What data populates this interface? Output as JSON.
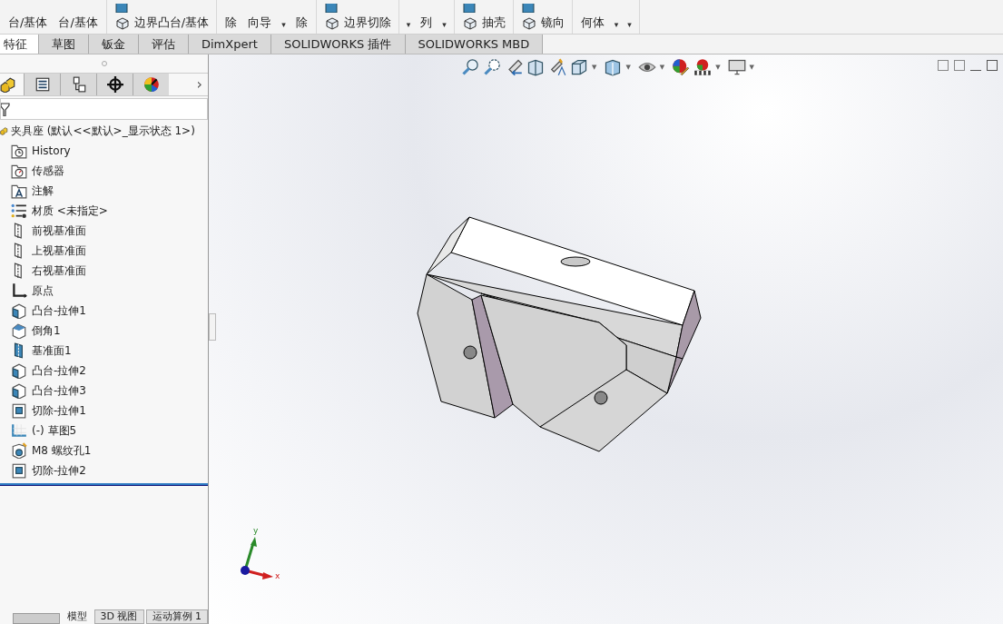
{
  "ribbon": {
    "groups": [
      {
        "items": [
          {
            "kind": "big",
            "label": "台/基体"
          },
          {
            "kind": "big",
            "label": "台/基体"
          }
        ]
      },
      {
        "items": [
          {
            "kind": "icon"
          },
          {
            "kind": "small",
            "label": "边界凸台/基体"
          }
        ]
      },
      {
        "items": [
          {
            "kind": "big",
            "label": "除"
          },
          {
            "kind": "big",
            "label": "向导"
          },
          {
            "kind": "caret",
            "label": "▾"
          },
          {
            "kind": "big",
            "label": "除"
          }
        ]
      },
      {
        "items": [
          {
            "kind": "icon"
          },
          {
            "kind": "small",
            "label": "边界切除"
          }
        ]
      },
      {
        "items": [
          {
            "kind": "caret",
            "label": "▾"
          },
          {
            "kind": "big",
            "label": "列"
          },
          {
            "kind": "caret",
            "label": "▾"
          }
        ]
      },
      {
        "items": [
          {
            "kind": "icon"
          },
          {
            "kind": "small",
            "label": "抽壳"
          }
        ]
      },
      {
        "items": [
          {
            "kind": "icon"
          },
          {
            "kind": "small",
            "label": "镜向"
          }
        ]
      },
      {
        "items": [
          {
            "kind": "big",
            "label": "何体"
          },
          {
            "kind": "caret",
            "label": "▾"
          },
          {
            "kind": "caret",
            "label": "▾"
          }
        ]
      }
    ]
  },
  "tabs": [
    {
      "label": "特征",
      "selected": true
    },
    {
      "label": "草图",
      "selected": false
    },
    {
      "label": "钣金",
      "selected": false
    },
    {
      "label": "评估",
      "selected": false
    },
    {
      "label": "DimXpert",
      "selected": false
    },
    {
      "label": "SOLIDWORKS 插件",
      "selected": false
    },
    {
      "label": "SOLIDWORKS MBD",
      "selected": false
    }
  ],
  "panel_tabs": [
    {
      "selected": true
    },
    {
      "selected": false
    },
    {
      "selected": false
    },
    {
      "selected": false
    },
    {
      "selected": false
    }
  ],
  "panel_more": "›",
  "tree": {
    "root": "夹具座  (默认<<默认>_显示状态 1>)",
    "children": [
      {
        "kind": "history",
        "label": "History"
      },
      {
        "kind": "sensor",
        "label": "传感器"
      },
      {
        "kind": "annotation",
        "label": "注解"
      },
      {
        "kind": "material",
        "label": "材质 <未指定>"
      },
      {
        "kind": "plane",
        "label": "前视基准面"
      },
      {
        "kind": "plane",
        "label": "上视基准面"
      },
      {
        "kind": "plane",
        "label": "右视基准面"
      },
      {
        "kind": "origin",
        "label": "原点"
      },
      {
        "kind": "boss",
        "label": "凸台-拉伸1"
      },
      {
        "kind": "chamfer",
        "label": "倒角1"
      },
      {
        "kind": "refplane",
        "label": "基准面1"
      },
      {
        "kind": "boss",
        "label": "凸台-拉伸2"
      },
      {
        "kind": "boss",
        "label": "凸台-拉伸3"
      },
      {
        "kind": "cut",
        "label": "切除-拉伸1"
      },
      {
        "kind": "sketch",
        "label": "(-) 草图5"
      },
      {
        "kind": "hole",
        "label": "M8 螺纹孔1"
      },
      {
        "kind": "cut",
        "label": "切除-拉伸2"
      }
    ]
  },
  "view_toolbar": [
    {
      "kind": "plain"
    },
    {
      "kind": "plain"
    },
    {
      "kind": "plain"
    },
    {
      "kind": "plain"
    },
    {
      "kind": "plain"
    },
    {
      "kind": "dropdown",
      "caret": "▼"
    },
    {
      "kind": "dropdown",
      "caret": "▼"
    },
    {
      "kind": "dropdown",
      "caret": "▼"
    },
    {
      "kind": "plain"
    },
    {
      "kind": "dropdown",
      "caret": "▼"
    },
    {
      "kind": "dropdown",
      "caret": "▼"
    }
  ],
  "triad": {
    "x_label": "x",
    "y_label": "y"
  },
  "bottom_tabs": [
    {
      "label": "模型",
      "selected": true
    },
    {
      "label": "3D 视图",
      "selected": false
    },
    {
      "label": "运动算例 1",
      "selected": false
    }
  ]
}
